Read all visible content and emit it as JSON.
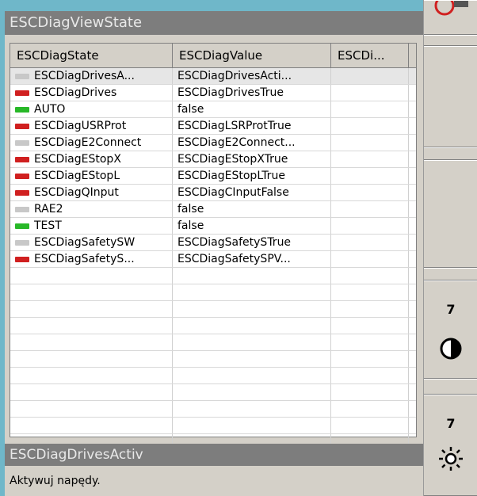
{
  "window": {
    "title": "ESCDiagViewState"
  },
  "table": {
    "columns": [
      "ESCDiagState",
      "ESCDiagValue",
      "ESCDi..."
    ],
    "rows": [
      {
        "lamp": "#c8c8c8",
        "state": "ESCDiagDrivesA...",
        "value": "ESCDiagDrivesActi...",
        "selected": true
      },
      {
        "lamp": "#d02020",
        "state": "ESCDiagDrives",
        "value": "ESCDiagDrivesTrue"
      },
      {
        "lamp": "#28b828",
        "state": "AUTO",
        "value": "false"
      },
      {
        "lamp": "#d02020",
        "state": "ESCDiagUSRProt",
        "value": "ESCDiagLSRProtTrue"
      },
      {
        "lamp": "#c8c8c8",
        "state": "ESCDiagE2Connect",
        "value": "ESCDiagE2Connect..."
      },
      {
        "lamp": "#d02020",
        "state": "ESCDiagEStopX",
        "value": "ESCDiagEStopXTrue"
      },
      {
        "lamp": "#d02020",
        "state": "ESCDiagEStopL",
        "value": "ESCDiagEStopLTrue"
      },
      {
        "lamp": "#d02020",
        "state": "ESCDiagQInput",
        "value": "ESCDiagCInputFalse"
      },
      {
        "lamp": "#c8c8c8",
        "state": "RAE2",
        "value": "false"
      },
      {
        "lamp": "#28b828",
        "state": "TEST",
        "value": "false"
      },
      {
        "lamp": "#c8c8c8",
        "state": "ESCDiagSafetySW",
        "value": "ESCDiagSafetySTrue"
      },
      {
        "lamp": "#d02020",
        "state": "ESCDiagSafetyS...",
        "value": "ESCDiagSafetySPV..."
      }
    ]
  },
  "status": {
    "name": "ESCDiagDrivesActiv",
    "description": "Aktywuj napędy."
  },
  "side_panel": {
    "contrast_value": "7",
    "brightness_value": "7"
  }
}
